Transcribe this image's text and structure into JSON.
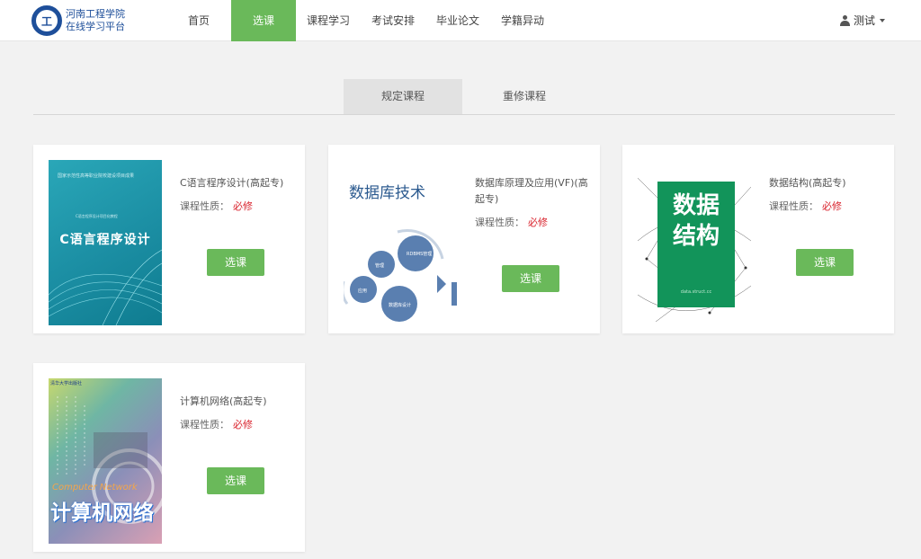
{
  "header": {
    "logo_text_line1": "河南工程学院",
    "logo_text_line2": "在线学习平台",
    "nav": [
      "首页",
      "选课",
      "课程学习",
      "考试安排",
      "毕业论文",
      "学籍异动"
    ],
    "active_nav": "选课",
    "user_name": "测试"
  },
  "tabs": [
    "规定课程",
    "重修课程"
  ],
  "colors": {
    "accent": "#6ab95a",
    "required": "#d9232d",
    "logo_blue": "#1e4f9a"
  },
  "courses": [
    {
      "title": "C语言程序设计(高起专)",
      "property_label": "课程性质：",
      "property_value": "必修",
      "button": "选课",
      "cover_title": "C语言程序设计",
      "cover_small": "国家示范性高等职业院校建设项目成果",
      "cover_small2": "C语言程序设计项目化教程"
    },
    {
      "title": "数据库原理及应用(VF)(高起专)",
      "property_label": "课程性质：",
      "property_value": "必修",
      "button": "选课",
      "cover_title": "数据库技术",
      "cover_gear1": "管理",
      "cover_gear2": "RDBMS管理",
      "cover_gear3": "应用",
      "cover_gear4": "数据库设计"
    },
    {
      "title": "数据结构(高起专)",
      "property_label": "课程性质：",
      "property_value": "必修",
      "button": "选课",
      "cover_title": "数据\n结构",
      "cover_small": "data.struct.cc"
    },
    {
      "title": "计算机网络(高起专)",
      "property_label": "课程性质：",
      "property_value": "必修",
      "button": "选课",
      "cover_en": "Computer Network",
      "cover_zh": "计算机网络",
      "cover_pub": "清华大学出版社"
    }
  ]
}
